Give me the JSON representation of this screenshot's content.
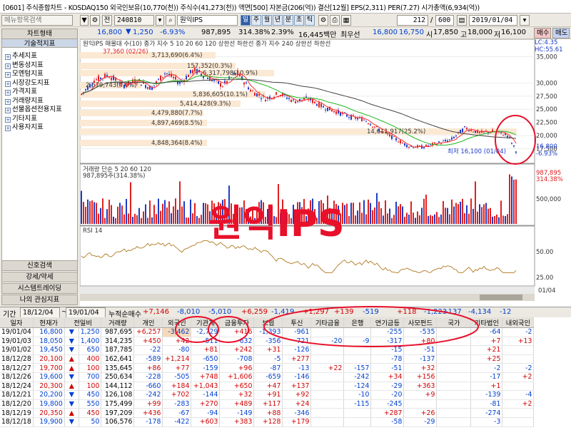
{
  "title_bar": {
    "text": "[0601] 주식종합차트 - KOSDAQ150  외국인보유(10,770(천)) 주식수(41,273(천)) 액면[500] 자본금(206(억)) 결산[12월] EPS(2,311) PER(7.27) 시가총액(6,934(억))"
  },
  "toolbar": {
    "search_placeholder": "메뉴항목검색",
    "code": "240810",
    "period": "전",
    "name": "원익IPS",
    "tabs": [
      "일",
      "주",
      "월",
      "년",
      "분",
      "초",
      "틱"
    ],
    "active_tab": "일",
    "count": "212",
    "total": "600",
    "date": "2019/01/04"
  },
  "quote": {
    "price": "16,800",
    "change": "1,250",
    "pct": "-6.93%",
    "volume": "987,895",
    "vol_ratio": "314.38%",
    "turnover": "2.39%",
    "amount": "16,445백만",
    "best": "최우선",
    "ask": "16,800",
    "bid": "16,750",
    "open_label": "시",
    "open": "17,850",
    "high_label": "고",
    "high": "18,000",
    "low_label": "저",
    "low": "16,100",
    "buy": "매수",
    "sell": "매도"
  },
  "sidebar": {
    "chart_type_btn": "차트형태",
    "tech_btn": "기술적지표",
    "items": [
      "추세지표",
      "변동성지표",
      "모멘텀지표",
      "시장강도지표",
      "가격지표",
      "거래량지표",
      "선물옵션전용지표",
      "기타지표",
      "사용자지표"
    ],
    "bottom_buttons": [
      "신호검색",
      "강세/약세",
      "시스템트레이딩",
      "나의 관심지표"
    ]
  },
  "chart": {
    "price_legend": "원익IPS 매물대 수(10)  종가 지수 5  10  20  60  120  상한선  하한선  종가 지수 240  상한선  하한선",
    "price_ticks": [
      "35,000",
      "30,000",
      "27,500",
      "25,000",
      "22,500",
      "20,000",
      "17,500",
      "16,800",
      "-6.93%"
    ],
    "lc": "LC:4.35",
    "hc": "HC:55.61",
    "hc_val": "37,360 (02/26)",
    "low_note": "최저 16,100 (01/04)",
    "volume_profile": [
      "3,713,690(6.4%)",
      "157,352(0.3%)",
      "6,317,798(10.9%)",
      "2,679,743(4.6%)",
      "5,836,605(10.1%)",
      "5,414,428(9.3%)",
      "4,479,880(7.7%)",
      "4,897,469(8.5%)",
      "14,611,917(25.2%)",
      "4,848,364(8.4%)"
    ],
    "vol_legend": "거래량 단순 5  20  60  120",
    "vol_value": "987,895주(314.38%)",
    "vol_ticks": [
      "987,895",
      "314.38%",
      "500,000"
    ],
    "rsi_legend": "RSI 14",
    "rsi_ticks": [
      "50.00",
      "25.00"
    ],
    "x_ticks": [
      "2018/02",
      "04",
      "05",
      "06",
      "07",
      "08",
      "09",
      "10",
      "11",
      "12",
      "2019/01",
      "01/04"
    ],
    "watermark": "원익IPS",
    "colors": {
      "ma5": "#ff2d2d",
      "ma20": "#1fb51f",
      "ma60": "#444444",
      "up": "#e02020",
      "down": "#1c3cc8",
      "rsi": "#b07820"
    }
  },
  "grid_header": {
    "label": "기간",
    "from": "18/12/04",
    "to": "19/01/04",
    "mode": "누적순매수",
    "totals": [
      "+7,146",
      "-8,010",
      "-5,010",
      "+6,259",
      "-1,419",
      "+1,297",
      "+139",
      "-519",
      "+118",
      "-1,223",
      "-137",
      "-4,134",
      "-12"
    ]
  },
  "table": {
    "columns": [
      "일자",
      "현재가",
      "전일비",
      "거래량",
      "개인",
      "외국인",
      "기관계",
      "금융투자",
      "보험",
      "투신",
      "기타금융",
      "은행",
      "연기금등",
      "사모펀드",
      "국가",
      "기타법인",
      "내외국인"
    ],
    "rows": [
      [
        "19/01/04",
        "16,800",
        "▼",
        "1,250",
        "987,695",
        "+6,257",
        "-3,462",
        "-2,729",
        "+416",
        "-1,393",
        "-961",
        "",
        "",
        "-255",
        "-535",
        "",
        "-64",
        "-2"
      ],
      [
        "19/01/03",
        "18,050",
        "▼",
        "1,400",
        "314,235",
        "+450",
        "+42",
        "-511",
        "-632",
        "-356",
        "-721",
        "-20",
        "-9",
        "-317",
        "+80",
        "",
        "+7",
        "+13"
      ],
      [
        "19/01/02",
        "19,450",
        "▼",
        "650",
        "187,785",
        "-22",
        "-80",
        "+81",
        "+242",
        "+31",
        "-126",
        "",
        "",
        "-15",
        "-51",
        "",
        "+21",
        ""
      ],
      [
        "18/12/28",
        "20,100",
        "▲",
        "400",
        "162,641",
        "-589",
        "+1,214",
        "-650",
        "-708",
        "-5",
        "+277",
        "",
        "",
        "-78",
        "-137",
        "",
        "+25",
        ""
      ],
      [
        "18/12/27",
        "19,700",
        "▲",
        "100",
        "135,645",
        "+86",
        "+77",
        "-159",
        "+96",
        "-87",
        "-13",
        "+22",
        "-157",
        "-51",
        "+32",
        "",
        "-2",
        "-2"
      ],
      [
        "18/12/26",
        "19,600",
        "▼",
        "700",
        "250,634",
        "-228",
        "-505",
        "+748",
        "+1,606",
        "-659",
        "-146",
        "",
        "-242",
        "+34",
        "+156",
        "",
        "-17",
        "+2"
      ],
      [
        "18/12/24",
        "20,300",
        "▲",
        "100",
        "144,112",
        "-660",
        "+184",
        "+1,043",
        "+650",
        "+47",
        "+137",
        "",
        "-124",
        "-29",
        "+363",
        "",
        "+1",
        ""
      ],
      [
        "18/12/21",
        "20,200",
        "▼",
        "450",
        "126,108",
        "-242",
        "+702",
        "-144",
        "+32",
        "+91",
        "+92",
        "",
        "-10",
        "-20",
        "+9",
        "",
        "-139",
        "-4"
      ],
      [
        "18/12/20",
        "19,800",
        "▼",
        "550",
        "175,499",
        "+99",
        "-283",
        "+270",
        "+489",
        "+117",
        "+24",
        "",
        "-115",
        "-245",
        "",
        "",
        "-81",
        "+2"
      ],
      [
        "18/12/19",
        "20,350",
        "▲",
        "450",
        "197,209",
        "+436",
        "-67",
        "-94",
        "-149",
        "+88",
        "-346",
        "",
        "",
        "+287",
        "+26",
        "",
        "-274",
        ""
      ],
      [
        "18/12/18",
        "19,900",
        "▼",
        "50",
        "106,576",
        "-178",
        "-422",
        "+603",
        "+383",
        "+128",
        "+179",
        "",
        "",
        "-58",
        "-29",
        "",
        "-3",
        ""
      ]
    ]
  }
}
